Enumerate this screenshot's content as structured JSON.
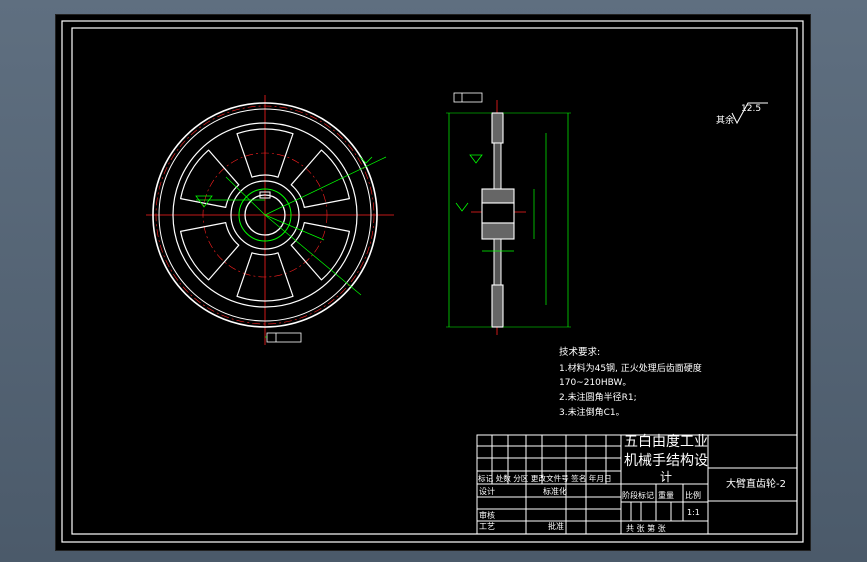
{
  "roughness": {
    "value": "12.5",
    "label": "其余"
  },
  "tech_requirements": {
    "title": "技术要求:",
    "lines": [
      "1.材料为45钢, 正火处理后齿面硬度",
      "170~210HBW。",
      "2.未注圆角半径R1;",
      "3.未注倒角C1。"
    ]
  },
  "title_block": {
    "school": "五白由度工业",
    "project": "机械手结构设",
    "project_cont": "计",
    "part_name": "大臂直齿轮-2",
    "header_row": "标记 处数 分区 更改文件号 签名 年月日",
    "design": "设计",
    "standardization": "标准化",
    "review": "审核",
    "process": "工艺",
    "approve": "批准",
    "stage_mark": "阶段标记",
    "weight": "重量",
    "scale_label": "比例",
    "scale_value": "1:1",
    "sheets": "共  张 第  张"
  }
}
